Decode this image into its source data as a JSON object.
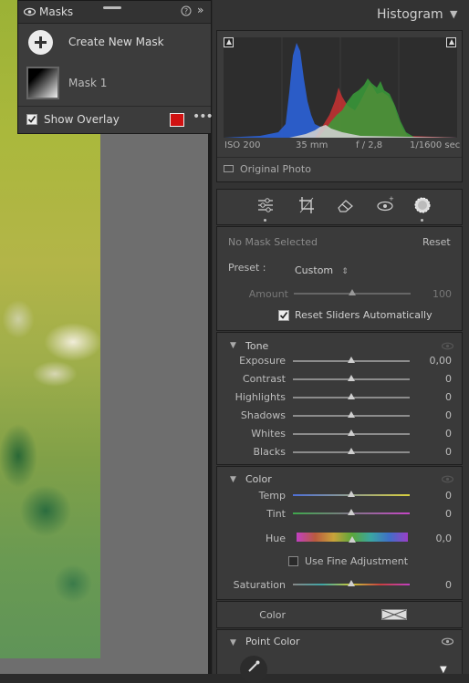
{
  "masks_panel": {
    "title": "Masks",
    "create_label": "Create New Mask",
    "mask1_label": "Mask 1",
    "show_overlay_label": "Show Overlay",
    "overlay_color": "#d01212"
  },
  "histogram": {
    "title": "Histogram",
    "iso": "ISO 200",
    "focal": "35 mm",
    "aperture": "f / 2,8",
    "shutter": "1/1600 sec",
    "original_photo_label": "Original Photo"
  },
  "mask_edit": {
    "status": "No Mask Selected",
    "reset_label": "Reset",
    "preset_label": "Preset :",
    "preset_value": "Custom",
    "amount_label": "Amount",
    "amount_value": "100",
    "reset_sliders_label": "Reset Sliders Automatically"
  },
  "tone": {
    "title": "Tone",
    "sliders": [
      {
        "label": "Exposure",
        "value": "0,00",
        "level": 0.5
      },
      {
        "label": "Contrast",
        "value": "0",
        "level": 0.5
      },
      {
        "label": "Highlights",
        "value": "0",
        "level": 0.5
      },
      {
        "label": "Shadows",
        "value": "0",
        "level": 0.5
      },
      {
        "label": "Whites",
        "value": "0",
        "level": 0.5
      },
      {
        "label": "Blacks",
        "value": "0",
        "level": 0.5
      }
    ]
  },
  "color": {
    "title": "Color",
    "temp_label": "Temp",
    "temp_value": "0",
    "tint_label": "Tint",
    "tint_value": "0",
    "hue_label": "Hue",
    "hue_value": "0,0",
    "fine_adjust_label": "Use Fine Adjustment",
    "saturation_label": "Saturation",
    "saturation_value": "0",
    "color_label": "Color"
  },
  "point_color": {
    "title": "Point Color"
  }
}
